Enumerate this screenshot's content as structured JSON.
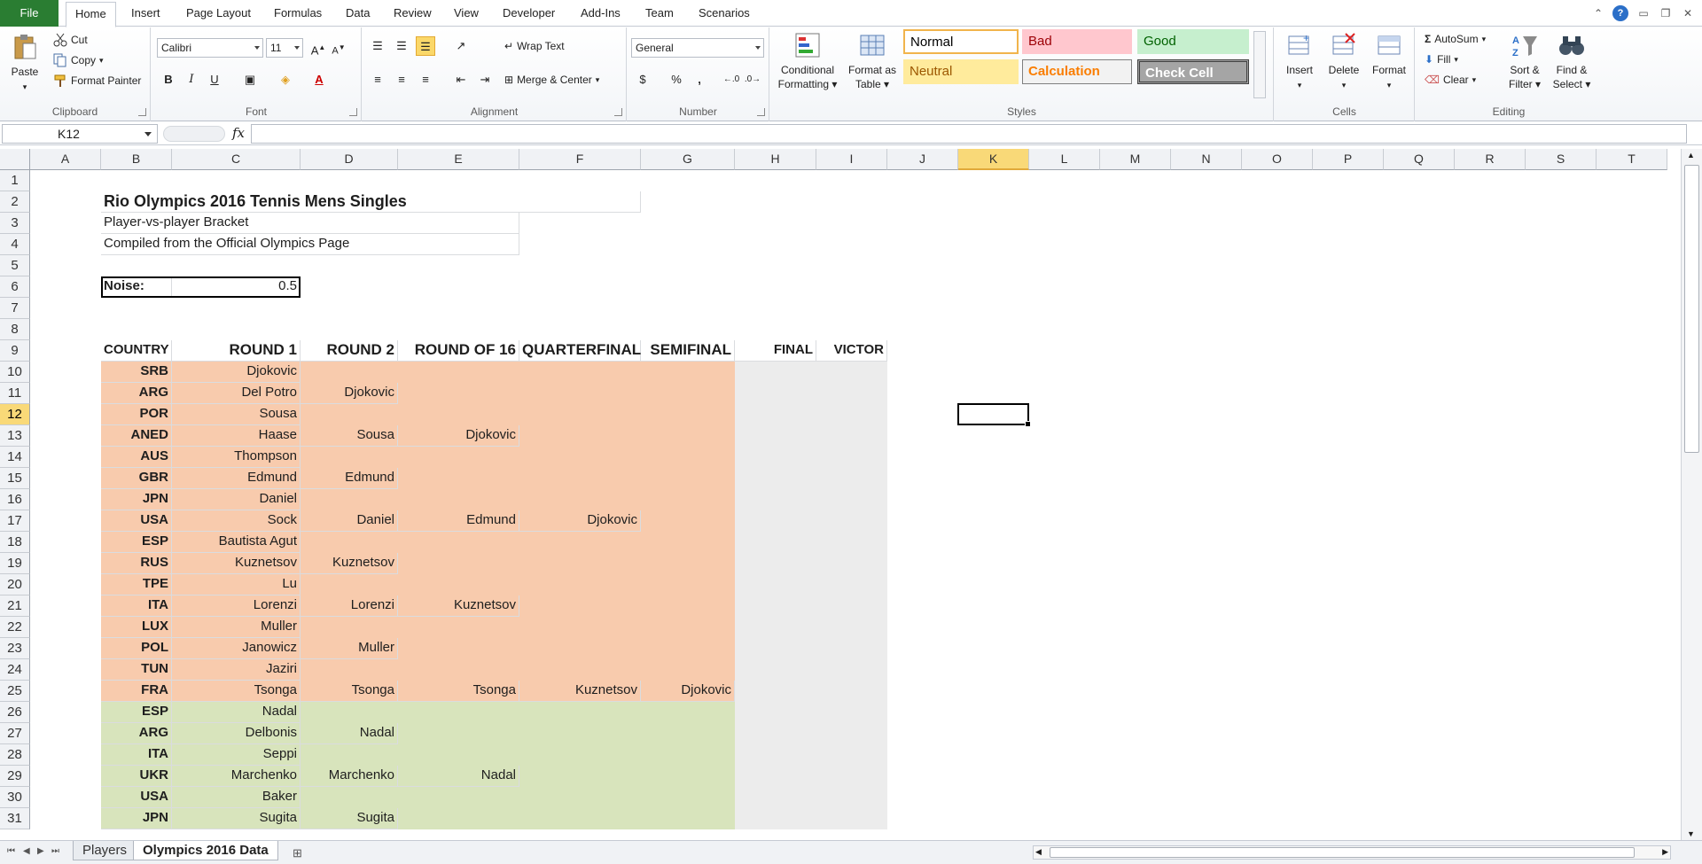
{
  "ribbon_tabs": [
    "File",
    "Home",
    "Insert",
    "Page Layout",
    "Formulas",
    "Data",
    "Review",
    "View",
    "Developer",
    "Add-Ins",
    "Team",
    "Scenarios"
  ],
  "active_tab": "Home",
  "clipboard": {
    "paste": "Paste",
    "cut": "Cut",
    "copy": "Copy",
    "format_painter": "Format Painter",
    "label": "Clipboard"
  },
  "font": {
    "name": "Calibri",
    "size": "11",
    "label": "Font",
    "bold": "B",
    "italic": "I",
    "underline": "U"
  },
  "alignment": {
    "wrap_text": "Wrap Text",
    "merge_center": "Merge & Center",
    "label": "Alignment"
  },
  "number": {
    "format": "General",
    "currency": "$",
    "percent": "%",
    "comma": ",",
    "label": "Number"
  },
  "styles": {
    "conditional_formatting": [
      "Conditional",
      "Formatting"
    ],
    "format_as_table": [
      "Format as",
      "Table"
    ],
    "cells": [
      "Normal",
      "Bad",
      "Good",
      "Neutral",
      "Calculation",
      "Check Cell"
    ],
    "label": "Styles"
  },
  "cells_group": {
    "insert": "Insert",
    "delete": "Delete",
    "format": "Format",
    "label": "Cells"
  },
  "editing": {
    "autosum": "AutoSum",
    "fill": "Fill",
    "clear": "Clear",
    "sort_filter": [
      "Sort &",
      "Filter"
    ],
    "find_select": [
      "Find &",
      "Select"
    ],
    "label": "Editing"
  },
  "formula_bar": {
    "name_box": "K12",
    "fx": "fx",
    "formula": ""
  },
  "columns": [
    "A",
    "B",
    "C",
    "D",
    "E",
    "F",
    "G",
    "H",
    "I",
    "J",
    "K",
    "L",
    "M",
    "N",
    "O",
    "P",
    "Q",
    "R",
    "S",
    "T"
  ],
  "selected_column": "K",
  "selected_row": 12,
  "rows": [
    1,
    2,
    3,
    4,
    5,
    6,
    7,
    8,
    9,
    10,
    11,
    12,
    13,
    14,
    15,
    16,
    17,
    18,
    19,
    20,
    21,
    22,
    23,
    24,
    25,
    26,
    27,
    28,
    29,
    30,
    31
  ],
  "sheet": {
    "title": "Rio Olympics 2016 Tennis Mens Singles",
    "subtitle": "Player-vs-player Bracket",
    "source": "Compiled from the Official Olympics Page",
    "noise_label": "Noise:",
    "noise_value": "0.5",
    "headers": [
      "COUNTRY",
      "ROUND 1",
      "ROUND 2",
      "ROUND OF 16",
      "QUARTERFINAL",
      "SEMIFINAL",
      "FINAL",
      "VICTOR"
    ],
    "bracket": [
      [
        "SRB",
        "Djokovic",
        "",
        "",
        "",
        ""
      ],
      [
        "ARG",
        "Del Potro",
        "Djokovic",
        "",
        "",
        ""
      ],
      [
        "POR",
        "Sousa",
        "",
        "",
        "",
        ""
      ],
      [
        "ANED",
        "Haase",
        "Sousa",
        "Djokovic",
        "",
        ""
      ],
      [
        "AUS",
        "Thompson",
        "",
        "",
        "",
        ""
      ],
      [
        "GBR",
        "Edmund",
        "Edmund",
        "",
        "",
        ""
      ],
      [
        "JPN",
        "Daniel",
        "",
        "",
        "",
        ""
      ],
      [
        "USA",
        "Sock",
        "Daniel",
        "Edmund",
        "Djokovic",
        ""
      ],
      [
        "ESP",
        "Bautista Agut",
        "",
        "",
        "",
        ""
      ],
      [
        "RUS",
        "Kuznetsov",
        "Kuznetsov",
        "",
        "",
        ""
      ],
      [
        "TPE",
        "Lu",
        "",
        "",
        "",
        ""
      ],
      [
        "ITA",
        "Lorenzi",
        "Lorenzi",
        "Kuznetsov",
        "",
        ""
      ],
      [
        "LUX",
        "Muller",
        "",
        "",
        "",
        ""
      ],
      [
        "POL",
        "Janowicz",
        "Muller",
        "",
        "",
        ""
      ],
      [
        "TUN",
        "Jaziri",
        "",
        "",
        "",
        ""
      ],
      [
        "FRA",
        "Tsonga",
        "Tsonga",
        "Tsonga",
        "Kuznetsov",
        "Djokovic"
      ],
      [
        "ESP",
        "Nadal",
        "",
        "",
        "",
        ""
      ],
      [
        "ARG",
        "Delbonis",
        "Nadal",
        "",
        "",
        ""
      ],
      [
        "ITA",
        "Seppi",
        "",
        "",
        "",
        ""
      ],
      [
        "UKR",
        "Marchenko",
        "Marchenko",
        "Nadal",
        "",
        ""
      ],
      [
        "USA",
        "Baker",
        "",
        "",
        "",
        ""
      ],
      [
        "JPN",
        "Sugita",
        "Sugita",
        "",
        "",
        ""
      ]
    ]
  },
  "sheet_tabs": [
    "Players",
    "Olympics 2016 Data"
  ],
  "active_sheet": "Olympics 2016 Data"
}
